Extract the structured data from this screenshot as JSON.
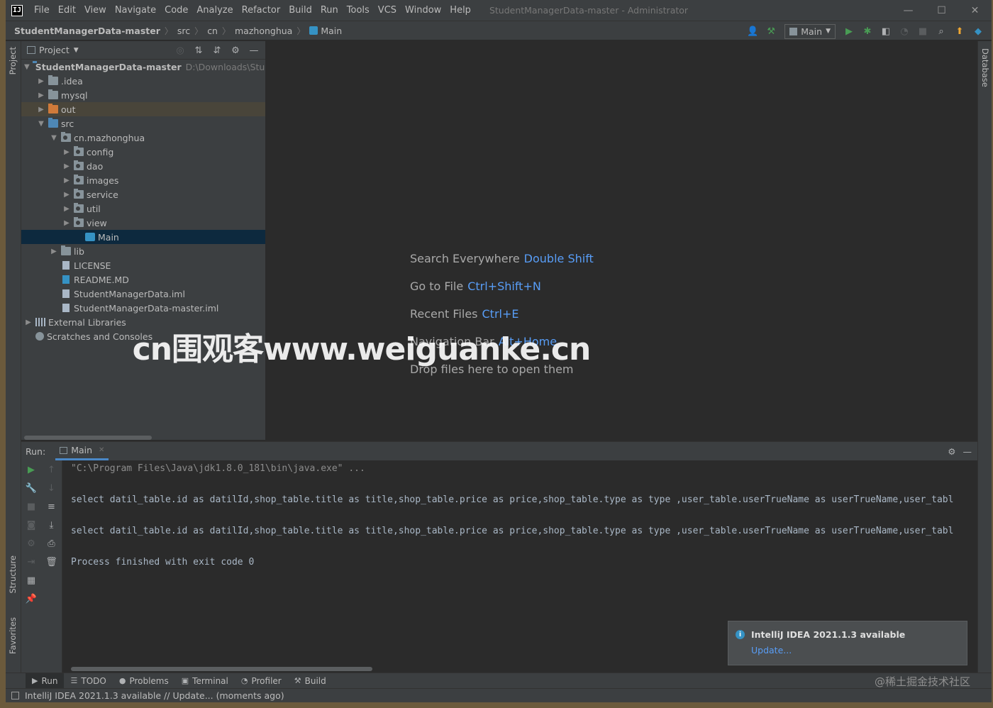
{
  "window": {
    "title": "StudentManagerData-master - Administrator",
    "logo": "IJ",
    "menu": [
      "File",
      "Edit",
      "View",
      "Navigate",
      "Code",
      "Analyze",
      "Refactor",
      "Build",
      "Run",
      "Tools",
      "VCS",
      "Window",
      "Help"
    ],
    "controls": {
      "minimize": "—",
      "maximize": "☐",
      "close": "✕"
    }
  },
  "navbar": {
    "breadcrumbs": [
      "StudentManagerData-master",
      "src",
      "cn",
      "mazhonghua",
      "Main"
    ],
    "run_config": "Main"
  },
  "side_tabs": {
    "project": "Project",
    "structure": "Structure",
    "favorites": "Favorites",
    "database": "Database"
  },
  "project_panel": {
    "title": "Project",
    "tree": [
      {
        "label": "StudentManagerData-master",
        "path": "D:\\Downloads\\Stude"
      },
      {
        "label": ".idea"
      },
      {
        "label": "mysql"
      },
      {
        "label": "out"
      },
      {
        "label": "src"
      },
      {
        "label": "cn.mazhonghua"
      },
      {
        "label": "config"
      },
      {
        "label": "dao"
      },
      {
        "label": "images"
      },
      {
        "label": "service"
      },
      {
        "label": "util"
      },
      {
        "label": "view"
      },
      {
        "label": "Main"
      },
      {
        "label": "lib"
      },
      {
        "label": "LICENSE"
      },
      {
        "label": "README.MD"
      },
      {
        "label": "StudentManagerData.iml"
      },
      {
        "label": "StudentManagerData-master.iml"
      },
      {
        "label": "External Libraries"
      },
      {
        "label": "Scratches and Consoles"
      }
    ]
  },
  "editor": {
    "hints": [
      {
        "text": "Search Everywhere",
        "key": "Double Shift"
      },
      {
        "text": "Go to File",
        "key": "Ctrl+Shift+N"
      },
      {
        "text": "Recent Files",
        "key": "Ctrl+E"
      },
      {
        "text": "Navigation Bar",
        "key": "Alt+Home"
      },
      {
        "text": "Drop files here to open them",
        "key": ""
      }
    ],
    "watermark": "cn围观客www.weiguanke.cn"
  },
  "run_panel": {
    "label": "Run:",
    "tab": "Main",
    "console": [
      "\"C:\\Program Files\\Java\\jdk1.8.0_181\\bin\\java.exe\" ...",
      "select datil_table.id as datilId,shop_table.title as title,shop_table.price as price,shop_table.type as type ,user_table.userTrueName as userTrueName,user_tabl",
      "select datil_table.id as datilId,shop_table.title as title,shop_table.price as price,shop_table.type as type ,user_table.userTrueName as userTrueName,user_tabl",
      "Process finished with exit code 0"
    ]
  },
  "notification": {
    "title": "IntelliJ IDEA 2021.1.3 available",
    "link": "Update..."
  },
  "bottom_tabs": [
    "Run",
    "TODO",
    "Problems",
    "Terminal",
    "Profiler",
    "Build"
  ],
  "status": "IntelliJ IDEA 2021.1.3 available // Update... (moments ago)",
  "credit": "@稀土掘金技术社区"
}
